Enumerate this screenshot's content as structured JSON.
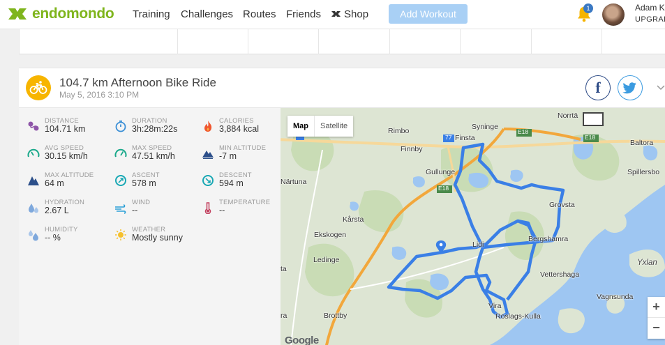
{
  "brand": {
    "name": "endomondo",
    "color": "#7fb51d"
  },
  "nav": {
    "training": "Training",
    "challenges": "Challenges",
    "routes": "Routes",
    "friends": "Friends",
    "shop": "Shop",
    "add_workout": "Add Workout"
  },
  "notifications": {
    "count": "1"
  },
  "user": {
    "name": "Adam Ka",
    "upgrade": "UPGRAD"
  },
  "workout": {
    "title": "104.7 km Afternoon Bike Ride",
    "datetime": "May 5, 2016 3:10 PM",
    "sport_icon": "bicycle-icon",
    "sport_color": "#f7b500"
  },
  "social": {
    "facebook": "f",
    "twitter_icon": "twitter-icon"
  },
  "stats": {
    "distance": {
      "label": "DISTANCE",
      "value": "104.71 km",
      "icon": "route-icon"
    },
    "duration": {
      "label": "DURATION",
      "value": "3h:28m:22s",
      "icon": "stopwatch-icon"
    },
    "calories": {
      "label": "CALORIES",
      "value": "3,884 kcal",
      "icon": "flame-icon"
    },
    "avg_speed": {
      "label": "AVG SPEED",
      "value": "30.15 km/h",
      "icon": "speedometer-icon"
    },
    "max_speed": {
      "label": "MAX SPEED",
      "value": "47.51 km/h",
      "icon": "speedometer-icon"
    },
    "min_altitude": {
      "label": "MIN ALTITUDE",
      "value": "-7 m",
      "icon": "mountain-icon"
    },
    "max_altitude": {
      "label": "MAX ALTITUDE",
      "value": "64 m",
      "icon": "mountain-icon"
    },
    "ascent": {
      "label": "ASCENT",
      "value": "578 m",
      "icon": "ascent-icon"
    },
    "descent": {
      "label": "DESCENT",
      "value": "594 m",
      "icon": "descent-icon"
    },
    "hydration": {
      "label": "HYDRATION",
      "value": "2.67 L",
      "icon": "water-drops-icon"
    },
    "wind": {
      "label": "WIND",
      "value": "--",
      "icon": "wind-icon"
    },
    "temperature": {
      "label": "TEMPERATURE",
      "value": "--",
      "icon": "thermometer-icon"
    },
    "humidity": {
      "label": "HUMIDITY",
      "value": "-- %",
      "icon": "humidity-icon"
    },
    "weather": {
      "label": "WEATHER",
      "value": "Mostly sunny",
      "icon": "sun-icon"
    }
  },
  "map": {
    "map_button": "Map",
    "satellite_button": "Satellite",
    "zoom_in": "+",
    "zoom_out": "−",
    "attribution": "Google",
    "route_color": "#3a7fe6",
    "water_color": "#9ec6f2",
    "places": {
      "norrtalje": "Norrtä",
      "rimbo": "Rimbo",
      "finsta": "Finsta",
      "syninge": "Syninge",
      "baltora": "Baltora",
      "finnby": "Finnby",
      "gullunge": "Gullunge",
      "nartuna": "Närtuna",
      "spillersbo": "Spillersbo",
      "grovsta": "Grovsta",
      "karsta": "Kårsta",
      "ekskogen": "Ekskogen",
      "bergshamra": "Bergshamra",
      "ledinge": "Ledinge",
      "lidi": "Lidi",
      "vettershaga": "Vettershaga",
      "ta": "ta",
      "ra": "ra",
      "yxlan": "Yxlan",
      "vagnsunda": "Vagnsunda",
      "vira": "Vira",
      "roslags_kulla": "Roslags-Kulla",
      "brottby": "Brottby",
      "e18_a": "E18",
      "e18_b": "E18",
      "e18_c": "E18",
      "r77": "77"
    }
  }
}
